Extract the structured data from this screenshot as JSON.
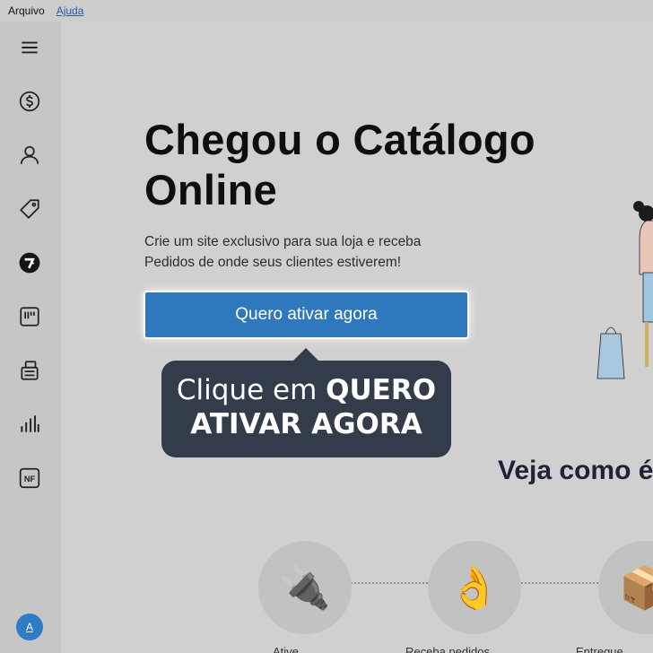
{
  "menubar": {
    "items": [
      "Arquivo",
      "Ajuda"
    ]
  },
  "sidebar": {
    "icons": [
      "menu-icon",
      "dollar-icon",
      "user-icon",
      "tag-icon",
      "ruler-icon",
      "barcode-icon",
      "stack-icon",
      "bar-chart-icon",
      "invoice-icon"
    ],
    "invoice_label": "NF",
    "avatar_letter": "A"
  },
  "hero": {
    "title": "Chegou o Catálogo Online",
    "subtitle": "Crie um site exclusivo para sua loja e receba Pedidos de onde seus clientes estiverem!",
    "cta_label": "Quero ativar agora"
  },
  "tooltip": {
    "prefix": "Clique em ",
    "bold": "QUERO ATIVAR AGORA"
  },
  "section": {
    "title": "Veja como é"
  },
  "steps": [
    {
      "icon": "🔌",
      "label": "Ative"
    },
    {
      "icon": "👌",
      "label": "Receba pedidos"
    },
    {
      "icon": "📦",
      "label": "Entregue"
    }
  ],
  "colors": {
    "cta": "#2f78bd",
    "tooltip_bg": "#333c4a",
    "avatar": "#2f7bc7"
  }
}
